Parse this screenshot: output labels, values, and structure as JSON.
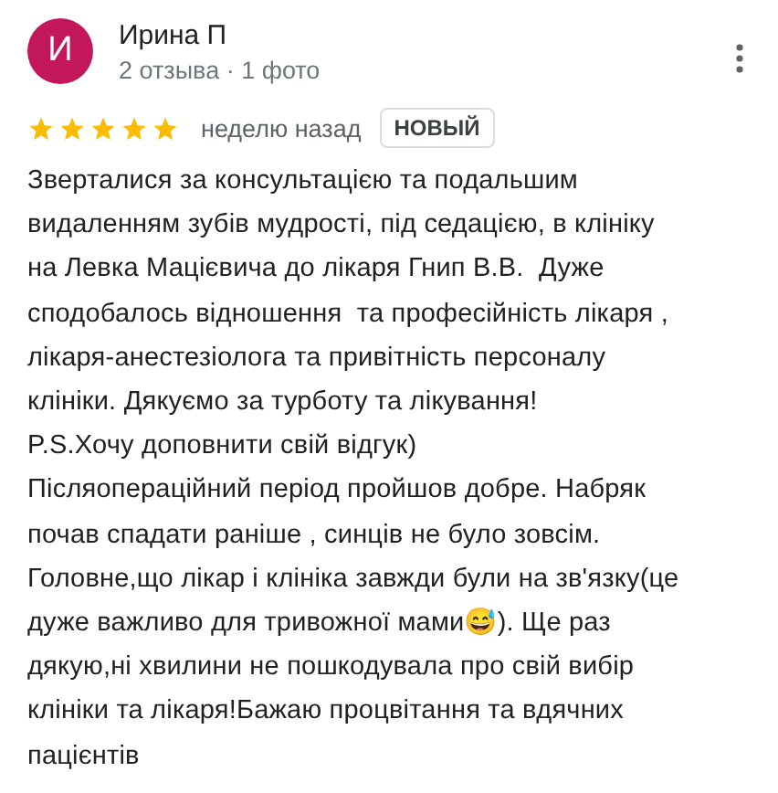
{
  "review": {
    "avatar_letter": "И",
    "author": "Ирина П",
    "author_meta": "2 отзыва · 1 фото",
    "stars": 5,
    "time": "неделю назад",
    "badge": "НОВЫЙ",
    "text_lines": [
      "Зверталися за консультацією та подальшим",
      "видаленням зубів мудрості, під седацією, в клініку",
      "на Левка Мацієвича до лікаря Гнип В.В.  Дуже",
      "сподобалось відношення  та професійність лікаря ,",
      "лікаря-анестезіолога та привітність персоналу",
      "клініки. Дякуємо за турботу та лікування!",
      "P.S.Хочу доповнити свій відгук)",
      "Післяопераційний період пройшов добре. Набряк",
      "почав спадати раніше , синців не було зовсім.",
      "Головне,що лікар і клініка завжди були на зв'язку(це",
      "дуже важливо для тривожної мами😅). Ще раз",
      "дякую,ні хвилини не пошкодувала про свій вибір",
      "клініки та лікаря!Бажаю процвітання та вдячних",
      "пацієнтів"
    ]
  }
}
